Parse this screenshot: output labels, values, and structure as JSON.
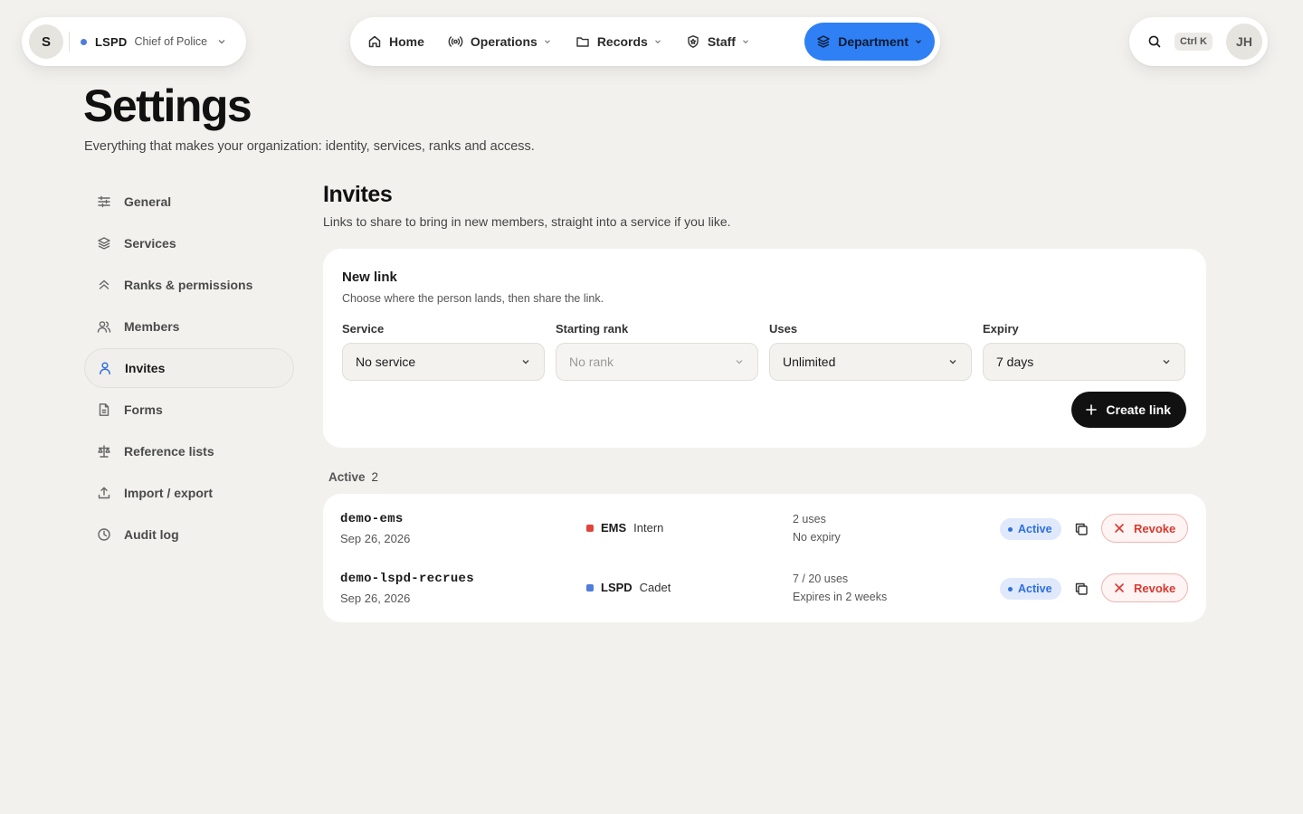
{
  "org": {
    "avatar_initial": "S",
    "name": "LSPD",
    "role": "Chief of Police",
    "dot_color": "#4f7ddb"
  },
  "nav": {
    "items": [
      {
        "label": "Home",
        "icon": "home-icon"
      },
      {
        "label": "Operations",
        "icon": "broadcast-icon"
      },
      {
        "label": "Records",
        "icon": "folder-icon"
      },
      {
        "label": "Staff",
        "icon": "shield-icon"
      },
      {
        "label": "Department",
        "icon": "layers-icon",
        "active": true
      }
    ],
    "accent": "#2f80f5"
  },
  "search": {
    "shortcut": "Ctrl K"
  },
  "user": {
    "initials": "JH"
  },
  "page": {
    "title": "Settings",
    "subtitle": "Everything that makes your organization: identity, services, ranks and access."
  },
  "sidebar": {
    "items": [
      {
        "label": "General",
        "icon": "sliders-icon"
      },
      {
        "label": "Services",
        "icon": "layers-icon"
      },
      {
        "label": "Ranks & permissions",
        "icon": "chevrons-up-icon"
      },
      {
        "label": "Members",
        "icon": "users-icon"
      },
      {
        "label": "Invites",
        "icon": "user-icon",
        "active": true
      },
      {
        "label": "Forms",
        "icon": "file-icon"
      },
      {
        "label": "Reference lists",
        "icon": "scale-icon"
      },
      {
        "label": "Import / export",
        "icon": "upload-icon"
      },
      {
        "label": "Audit log",
        "icon": "clock-icon"
      }
    ]
  },
  "section": {
    "title": "Invites",
    "subtitle": "Links to share to bring in new members, straight into a service if you like."
  },
  "new_link": {
    "title": "New link",
    "subtitle": "Choose where the person lands, then share the link.",
    "fields": [
      {
        "label": "Service",
        "value": "No service"
      },
      {
        "label": "Starting rank",
        "value": "No rank",
        "disabled": true
      },
      {
        "label": "Uses",
        "value": "Unlimited"
      },
      {
        "label": "Expiry",
        "value": "7 days"
      }
    ],
    "create_label": "Create link"
  },
  "active": {
    "label": "Active",
    "count": "2",
    "rows": [
      {
        "code": "demo-ems",
        "date": "Sep 26, 2026",
        "service": "EMS",
        "service_color": "#e0443a",
        "rank": "Intern",
        "uses": "2 uses",
        "expiry": "No expiry",
        "status": "Active",
        "revoke": "Revoke"
      },
      {
        "code": "demo-lspd-recrues",
        "date": "Sep 26, 2026",
        "service": "LSPD",
        "service_color": "#4f7ddb",
        "rank": "Cadet",
        "uses": "7 / 20 uses",
        "expiry": "Expires in 2 weeks",
        "status": "Active",
        "revoke": "Revoke"
      }
    ]
  }
}
